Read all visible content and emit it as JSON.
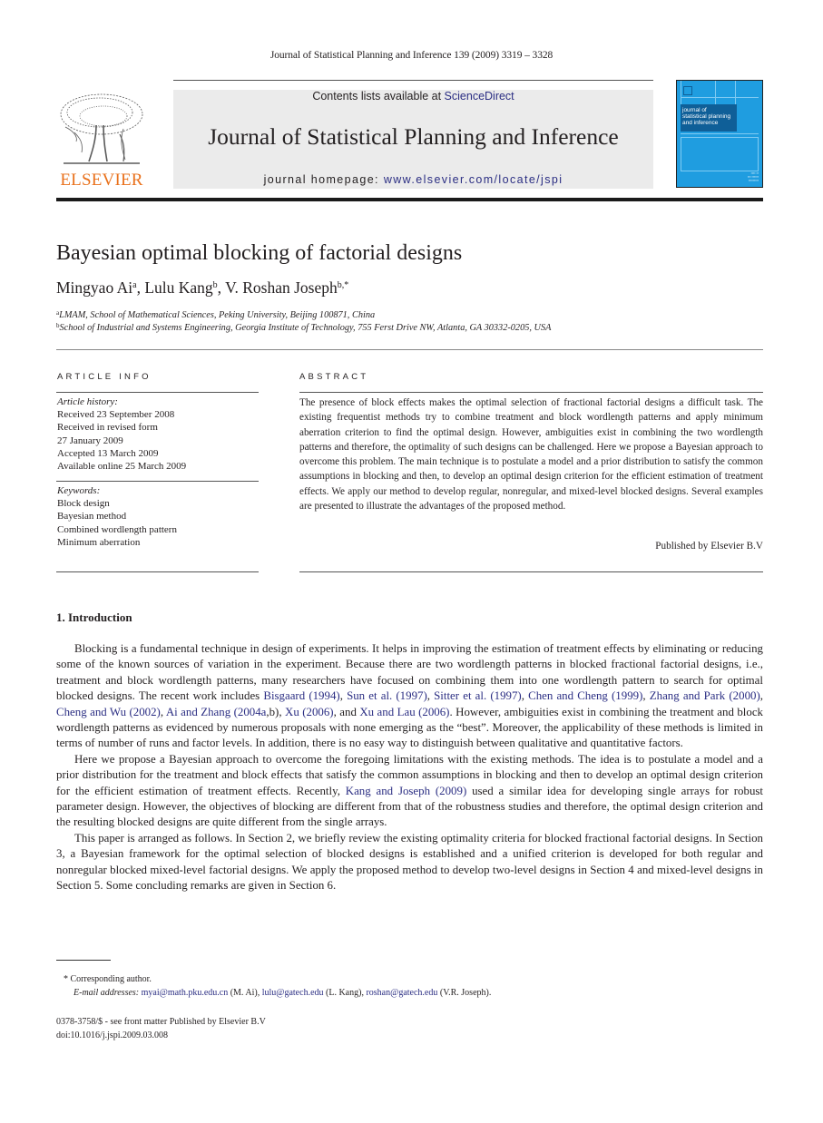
{
  "header": {
    "running_head": "Journal of Statistical Planning and Inference 139 (2009) 3319 – 3328",
    "publisher_logo_text": "ELSEVIER",
    "contents_prefix": "Contents lists available at ",
    "contents_link": "ScienceDirect",
    "journal_title": "Journal of Statistical Planning and Inference",
    "homepage_prefix": "journal homepage: ",
    "homepage_link": "www.elsevier.com/locate/jspi",
    "cover_title_lines": [
      "journal of",
      "statistical planning",
      "and inference"
    ]
  },
  "article": {
    "title": "Bayesian optimal blocking of factorial designs",
    "authors": [
      {
        "name": "Mingyao Ai",
        "marks": "a",
        "sep": ", "
      },
      {
        "name": "Lulu Kang",
        "marks": "b",
        "sep": ", "
      },
      {
        "name": "V. Roshan Joseph",
        "marks": "b,*",
        "sep": ""
      }
    ],
    "affiliations": [
      {
        "mark": "a",
        "text": "LMAM, School of Mathematical Sciences, Peking University, Beijing 100871, China"
      },
      {
        "mark": "b",
        "text": "School of Industrial and Systems Engineering, Georgia Institute of Technology, 755 Ferst Drive NW, Atlanta, GA 30332-0205, USA"
      }
    ]
  },
  "article_info": {
    "heading": "ARTICLE INFO",
    "history_label": "Article history:",
    "history": [
      "Received 23 September 2008",
      "Received in revised form",
      "27 January 2009",
      "Accepted 13 March 2009",
      "Available online 25 March 2009"
    ],
    "keywords_label": "Keywords:",
    "keywords": [
      "Block design",
      "Bayesian method",
      "Combined wordlength pattern",
      "Minimum aberration"
    ]
  },
  "abstract": {
    "heading": "ABSTRACT",
    "text": "The presence of block effects makes the optimal selection of fractional factorial designs a difficult task. The existing frequentist methods try to combine treatment and block wordlength patterns and apply minimum aberration criterion to find the optimal design. However, ambiguities exist in combining the two wordlength patterns and therefore, the optimality of such designs can be challenged. Here we propose a Bayesian approach to overcome this problem. The main technique is to postulate a model and a prior distribution to satisfy the common assumptions in blocking and then, to develop an optimal design criterion for the efficient estimation of treatment effects. We apply our method to develop regular, nonregular, and mixed-level blocked designs. Several examples are presented to illustrate the advantages of the proposed method.",
    "publisher_note": "Published by Elsevier B.V"
  },
  "introduction": {
    "heading": "1.  Introduction",
    "paragraphs": [
      [
        {
          "t": "Blocking is a fundamental technique in design of experiments. It helps in improving the estimation of treatment effects by eliminating or reducing some of the known sources of variation in the experiment. Because there are two wordlength patterns in blocked fractional factorial designs, i.e., treatment and block wordlength patterns, many researchers have focused on combining them into one wordlength pattern to search for optimal blocked designs. The recent work includes "
        },
        {
          "t": "Bisgaard (1994)",
          "link": true
        },
        {
          "t": ", "
        },
        {
          "t": "Sun et al. (1997)",
          "link": true
        },
        {
          "t": ", "
        },
        {
          "t": "Sitter et al. (1997)",
          "link": true
        },
        {
          "t": ", "
        },
        {
          "t": "Chen and Cheng (1999)",
          "link": true
        },
        {
          "t": ", "
        },
        {
          "t": "Zhang and Park (2000)",
          "link": true
        },
        {
          "t": ", "
        },
        {
          "t": "Cheng and Wu (2002)",
          "link": true
        },
        {
          "t": ", "
        },
        {
          "t": "Ai and Zhang (2004a",
          "link": true
        },
        {
          "t": ",b), "
        },
        {
          "t": "Xu (2006)",
          "link": true
        },
        {
          "t": ", and "
        },
        {
          "t": "Xu and Lau (2006)",
          "link": true
        },
        {
          "t": ". However, ambiguities exist in combining the treatment and block wordlength patterns as evidenced by numerous proposals with none emerging as the “best”. Moreover, the applicability of these methods is limited in terms of number of runs and factor levels. In addition, there is no easy way to distinguish between qualitative and quantitative factors."
        }
      ],
      [
        {
          "t": "Here we propose a Bayesian approach to overcome the foregoing limitations with the existing methods. The idea is to postulate a model and a prior distribution for the treatment and block effects that satisfy the common assumptions in blocking and then to develop an optimal design criterion for the efficient estimation of treatment effects. Recently, "
        },
        {
          "t": "Kang and Joseph (2009)",
          "link": true
        },
        {
          "t": " used a similar idea for developing single arrays for robust parameter design. However, the objectives of blocking are different from that of the robustness studies and therefore, the optimal design criterion and the resulting blocked designs are quite different from the single arrays."
        }
      ],
      [
        {
          "t": "This paper is arranged as follows. In Section 2, we briefly review the existing optimality criteria for blocked fractional factorial designs. In Section 3, a Bayesian framework for the optimal selection of blocked designs is established and a unified criterion is developed for both regular and nonregular blocked mixed-level factorial designs. We apply the proposed method to develop two-level designs in Section 4 and mixed-level designs in Section 5. Some concluding remarks are given in Section 6."
        }
      ]
    ]
  },
  "footnotes": {
    "corresponding": "* Corresponding author.",
    "emails_label": "E-mail addresses: ",
    "emails": [
      {
        "email": "myai@math.pku.edu.cn",
        "who": " (M. Ai), "
      },
      {
        "email": "lulu@gatech.edu",
        "who": " (L. Kang), "
      },
      {
        "email": "roshan@gatech.edu",
        "who": " (V.R. Joseph)."
      }
    ]
  },
  "bottom_meta": {
    "issn_line": "0378-3758/$ - see front matter Published by Elsevier B.V",
    "doi": "doi:10.1016/j.jspi.2009.03.008"
  },
  "colors": {
    "link": "#2b2e83",
    "elsevier_orange": "#e9711c",
    "banner_bg": "#ebebeb",
    "cover_blue": "#1f9de0",
    "cover_panel": "#0f5f98"
  }
}
